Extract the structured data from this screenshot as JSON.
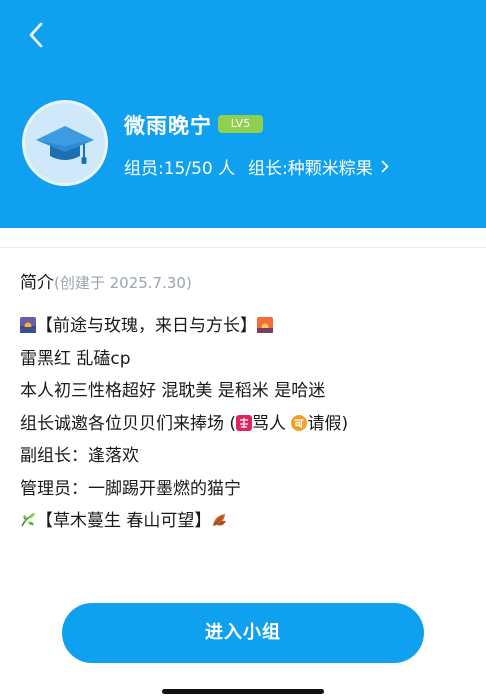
{
  "group": {
    "name": "微雨晚宁",
    "level": "LV5",
    "members": "组员:15/50 人",
    "leader": "组长:种颗米粽果"
  },
  "intro": {
    "title": "简介",
    "created": "(创建于 2025.7.30)",
    "line1_text": "【前途与玫瑰，来日与方长】",
    "line2": "雷黑红  乱磕cp",
    "line3": "本人初三性格超好 混耽美  是稻米 是哈迷",
    "line4_pre": "组长诚邀各位贝贝们来捧场 (",
    "line4_mid": "骂人 ",
    "line4_post": "请假)",
    "line5": "副组长：逢落欢",
    "line6": "管理员：一脚踢开墨燃的猫宁",
    "line7_text": "【草木蔓生 春山可望】"
  },
  "actions": {
    "join_label": "进入小组"
  },
  "colors": {
    "header_bg": "#0fa0f0",
    "level_badge": "#8fd14f",
    "button_bg": "#0fa0f0"
  },
  "icons": {
    "back": "chevron-left-icon",
    "avatar": "graduation-cap-icon",
    "leader_chevron": "chevron-right-icon",
    "line1_start": "sunrise-icon",
    "line1_end": "sunset-icon",
    "forbidden": "forbidden-ideograph-icon",
    "acceptable": "acceptable-ideograph-icon",
    "line7_start": "herb-icon",
    "line7_end": "fallen-leaf-icon"
  }
}
